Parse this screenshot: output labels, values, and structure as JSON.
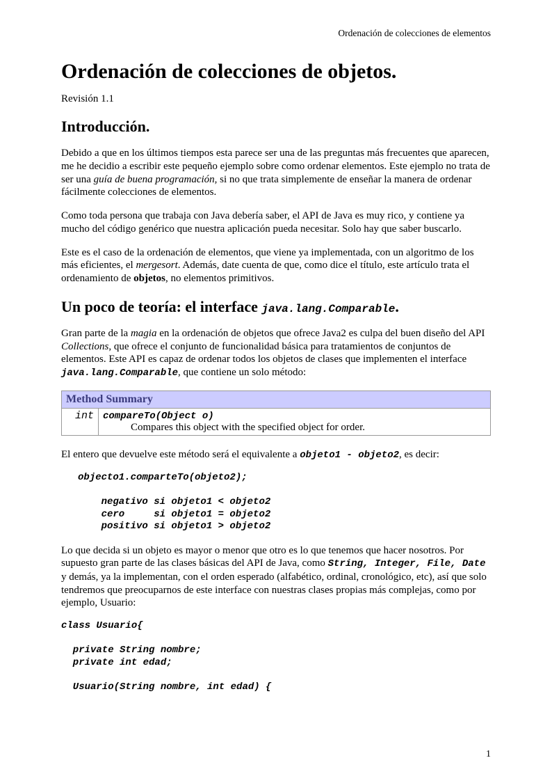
{
  "header": {
    "running": "Ordenación de colecciones de elementos"
  },
  "title": "Ordenación de colecciones de objetos.",
  "revision": "Revisión 1.1",
  "sections": {
    "intro_heading": "Introducción.",
    "intro_p1_a": "Debido a que en los últimos tiempos esta parece ser una de las preguntas más frecuentes que aparecen, me he decidio a escribir este pequeño ejemplo sobre como ordenar elementos. Este ejemplo no trata de ser una ",
    "intro_p1_em": "guía de buena programación",
    "intro_p1_b": ", si no que trata simplemente de enseñar la manera de ordenar fácilmente colecciones de elementos.",
    "intro_p2": "Como toda persona que trabaja con Java debería saber, el API de Java es muy rico, y contiene ya mucho del código genérico que nuestra aplicación pueda necesitar. Solo hay que saber buscarlo.",
    "intro_p3_a": "Este es el caso de la ordenación de elementos, que viene ya implementada, con un algoritmo de los más eficientes, el ",
    "intro_p3_em": "mergesort",
    "intro_p3_b": ". Además, date cuenta de que, como dice el título, este artículo trata el ordenamiento de ",
    "intro_p3_strong": "objetos",
    "intro_p3_c": ", no elementos primitivos.",
    "theory_heading_a": "Un poco de teoría: el interface ",
    "theory_heading_code": "java.lang.Comparable",
    "theory_heading_b": ".",
    "theory_p1_a": "Gran parte de la ",
    "theory_p1_em1": "magia",
    "theory_p1_b": " en la ordenación de objetos que ofrece Java2 es culpa del buen diseño del API ",
    "theory_p1_em2": "Collections",
    "theory_p1_c": ", que ofrece el conjunto de funcionalidad básica para tratamientos de conjuntos de elementos. Este API es capaz de ordenar todos los objetos de clases que implementen el interface ",
    "theory_p1_code": "java.lang.Comparable",
    "theory_p1_d": ", que contiene un solo método:",
    "table": {
      "header": "Method Summary",
      "ret": " int",
      "sig": "compareTo(Object o)",
      "desc": "Compares this object with the specified object for order."
    },
    "theory_p2_a": "El entero que devuelve este método será el equivalente a ",
    "theory_p2_code": "objeto1 - objeto2",
    "theory_p2_b": ", es decir:",
    "codeblock1": "objecto1.comparteTo(objeto2);\n\n    negativo si objeto1 < objeto2\n    cero     si objeto1 = objeto2\n    positivo si objeto1 > objeto2",
    "theory_p3_a": "Lo que decida si un objeto es mayor o menor que otro es lo que tenemos que hacer nosotros. Por supuesto gran parte de las clases básicas del API de Java, como ",
    "theory_p3_code": "String, Integer, File, Date",
    "theory_p3_b": " y demás, ya la implementan, con el orden esperado (alfabético, ordinal, cronológico, etc), así que solo tendremos que preocuparnos de este interface con nuestras clases propias más complejas, como por ejemplo, Usuario:",
    "codeblock2": "class Usuario{\n\n  private String nombre;\n  private int edad;\n\n  Usuario(String nombre, int edad) {"
  },
  "footer": {
    "page": "1"
  }
}
